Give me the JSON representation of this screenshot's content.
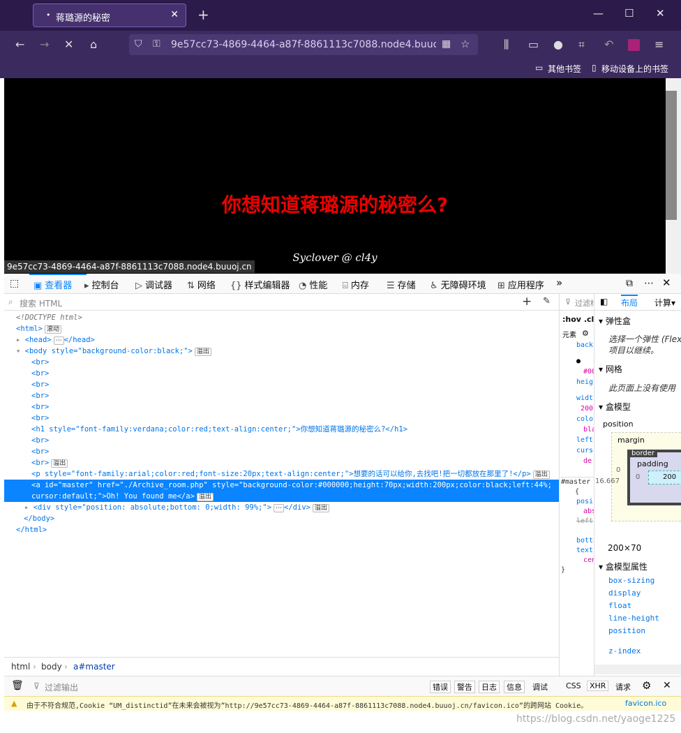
{
  "browser": {
    "tab_title": "蒋璐源的秘密",
    "url": "9e57cc73-4869-4464-a87f-8861113c7088.node4.buuoj.cn",
    "bookmarks": [
      "其他书签",
      "移动设备上的书签"
    ]
  },
  "page": {
    "heading": "你想知道蒋璐源的秘密么?",
    "signature": "Syclover @ cl4y",
    "status_link": "9e57cc73-4869-4464-a87f-8861113c7088.node4.buuoj.cn"
  },
  "devtools": {
    "tabs": [
      "查看器",
      "控制台",
      "调试器",
      "网络",
      "样式编辑器",
      "性能",
      "内存",
      "存储",
      "无障碍环境",
      "应用程序"
    ],
    "search_placeholder": "搜索 HTML",
    "badges": {
      "scroll": "滚动",
      "event": "溢出"
    },
    "tree": {
      "doctype": "<!DOCTYPE html>",
      "html_open": "<html>",
      "head": "<head>",
      "head_close": "</head>",
      "body_open": "<body style=\"background-color:black;\">",
      "br": "<br>",
      "h1": "<h1 style=\"font-family:verdana;color:red;text-align:center;\">你想知道蒋璐源的秘密么?</h1>",
      "p": "<p style=\"font-family:arial;color:red;font-size:20px;text-align:center;\">想要的话可以给你,去找吧!把一切都放在那里了!</p>",
      "a_line1": "<a id=\"master\" href=\"./Archive_room.php\" style=\"background-color:#000000;height:70px;width:200px;color:black;left:44%;",
      "a_line2": "cursor:default;\">Oh! You found me</a>",
      "div": "<div style=\"position: absolute;bottom: 0;width: 99%;\">",
      "div_close": "</div>",
      "body_close": "</body>",
      "html_close": "</html>"
    },
    "breadcrumb": [
      "html",
      "body",
      "a#master"
    ],
    "rules": {
      "filter": "过滤样",
      "hov": ":hov",
      "cls": ".cl",
      "element": "元素",
      "lines": [
        "back",
        "#00",
        "heig",
        "widt",
        "200",
        "colo",
        "bla",
        "left",
        "curs",
        "de",
        "#master",
        "{",
        "posi",
        "abs",
        "left",
        "botto",
        "text",
        "cen",
        "}"
      ]
    },
    "layout": {
      "tabs": [
        "布局",
        "计算"
      ],
      "flex_title": "弹性盒",
      "flex_desc": "选择一个弹性 (Flex)",
      "flex_desc2": "项目以继续。",
      "grid_title": "网格",
      "grid_desc": "此页面上没有使用",
      "box_title": "盒模型",
      "position": "position",
      "margin": "margin",
      "border": "border",
      "padding": "padding",
      "size": "200×70",
      "left_val": "16.667",
      "zero": "0",
      "content_w": "200",
      "props_title": "盒模型属性",
      "props": [
        "box-sizing",
        "display",
        "float",
        "line-height",
        "position",
        "z-index"
      ]
    },
    "console": {
      "filter": "过滤输出",
      "buttons": [
        "错误",
        "警告",
        "日志",
        "信息",
        "调试"
      ],
      "right": [
        "CSS",
        "XHR",
        "请求"
      ]
    },
    "warning": "由于不符合规范,Cookie “UM_distinctid”在未来会被视为”http://9e57cc73-4869-4464-a87f-8861113c7088.node4.buuoj.cn/favicon.ico”的跨网站 Cookie。",
    "warning_link": "favicon.ico"
  },
  "watermark": "https://blog.csdn.net/yaoge1225",
  "colors": {
    "accent": "#0a84ff",
    "titlebar": "#2b1a4a",
    "heading": "#ff0000"
  }
}
